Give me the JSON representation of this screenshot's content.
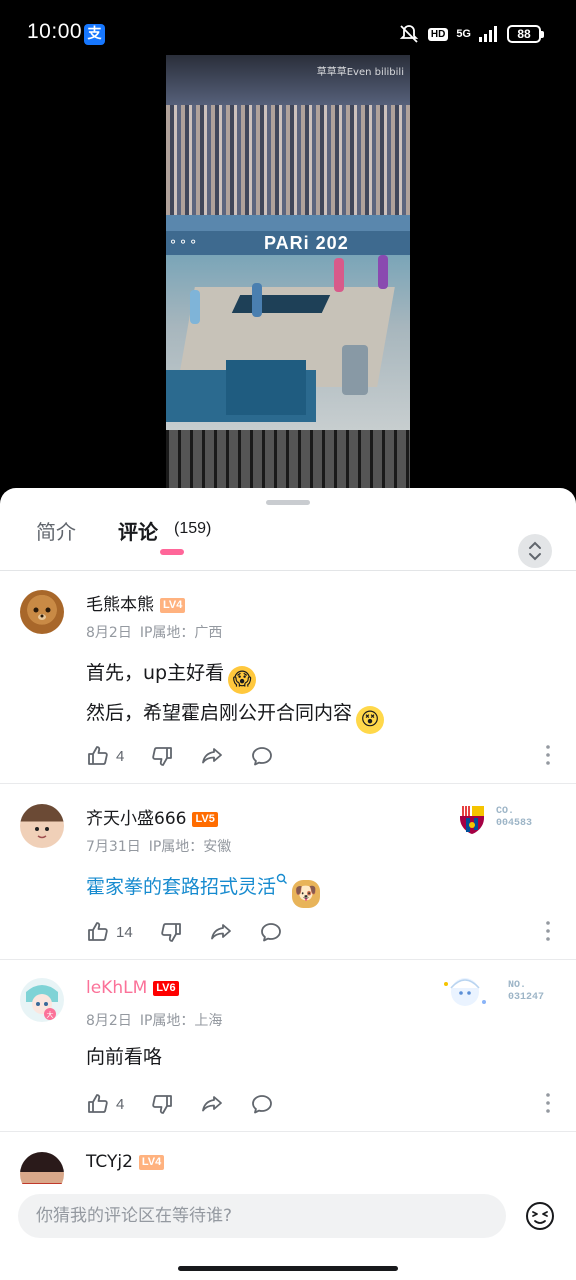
{
  "status_bar": {
    "time": "10:00",
    "app_badge": "支",
    "hd": "HD",
    "network": "5G",
    "battery": "88"
  },
  "video": {
    "watermark": "草草草Even bilibili",
    "venue_text": "PARi 202"
  },
  "tabs": {
    "intro": "简介",
    "comments": "评论",
    "comment_count": "(159)"
  },
  "comments": [
    {
      "username": "毛熊本熊",
      "level": "LV4",
      "date": "8月2日",
      "location": "IP属地：广西",
      "lines": [
        "首先，up主好看",
        "然后，希望霍启刚公开合同内容"
      ],
      "likes": "4"
    },
    {
      "username": "齐天小盛666",
      "level": "LV5",
      "date": "7月31日",
      "location": "IP属地：安徽",
      "lines": [
        "霍家拳的套路招式灵活"
      ],
      "likes": "14",
      "fan_badge_no": "CO.\n004583"
    },
    {
      "username": "leKhLM",
      "level": "LV6",
      "date": "8月2日",
      "location": "IP属地：上海",
      "lines": [
        "向前看咯"
      ],
      "likes": "4",
      "fan_badge_no": "NO.\n031247"
    },
    {
      "username": "TCYj2",
      "level": "LV4"
    }
  ],
  "input": {
    "placeholder": "你猜我的评论区在等待谁?"
  }
}
